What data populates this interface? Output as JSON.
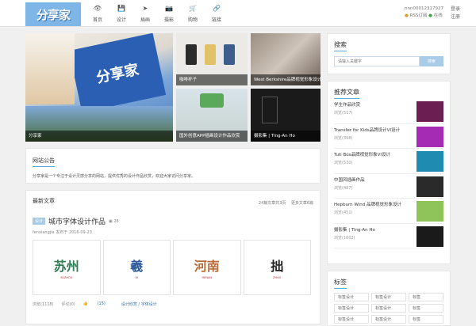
{
  "header": {
    "logo_text": "分享家",
    "nav": [
      {
        "icon": "eye-icon",
        "glyph": "👁",
        "label": "首页"
      },
      {
        "icon": "save-icon",
        "glyph": "💾",
        "label": "设计"
      },
      {
        "icon": "send-icon",
        "glyph": "➤",
        "label": "插画"
      },
      {
        "icon": "camera-icon",
        "glyph": "📷",
        "label": "摄影"
      },
      {
        "icon": "cart-icon",
        "glyph": "🛒",
        "label": "购物"
      },
      {
        "icon": "link-icon",
        "glyph": "🔗",
        "label": "链接"
      }
    ],
    "user_id": "nnn00012317927",
    "rss_label": "RSS订阅",
    "online_label": "在线",
    "login": "登录",
    "register": "注册"
  },
  "featured": {
    "main_caption": "分享家",
    "tile2_caption": "咖啡杯子",
    "tile3_caption": "West Berkshire品牌视觉形象设计",
    "tile4_caption": "国外创意APP插画设计作品欣赏",
    "tile5_caption": "摄影集 | Ting-An Ho"
  },
  "notice": {
    "title": "网站公告",
    "text": "分享家是一个专注于设计灵感分享的网站，提供优秀的设计作品欣赏，欢迎大家访问分享家。"
  },
  "latest": {
    "title": "最新文章",
    "count_text": "24篇文章共3页",
    "more_text": "更多文章6篇",
    "post": {
      "tag": "设计",
      "title": "城市字体设计作品",
      "pic_count": "28",
      "author": "fenxiangjia",
      "category": "发布于",
      "date": "2016-09-23"
    },
    "thumbs": [
      {
        "big": "苏州",
        "small": "SUZHOU",
        "color": "#2e7d55"
      },
      {
        "big": "羲",
        "small": "XI",
        "color": "#2d5a9e"
      },
      {
        "big": "河南",
        "small": "HENAN",
        "color": "#b86a36"
      },
      {
        "big": "拙",
        "small": "ZHUO",
        "color": "#222"
      }
    ],
    "views": "浏览(1118)",
    "comments": "评论(0)",
    "likes": "(15)",
    "links": "设计欣赏 / 字体设计"
  },
  "sidebar": {
    "search_title": "搜索",
    "search_placeholder": "请输入关键字",
    "search_button": "搜索",
    "rec_title": "推荐文章",
    "rec_items": [
      {
        "name": "学生作品欣赏",
        "views": "浏览(517)",
        "color": "#6a1e52"
      },
      {
        "name": "Transfer for Kids品牌设计VI设计",
        "views": "浏览(398)",
        "color": "#a52bb5"
      },
      {
        "name": "Tuti Box品牌视觉形象VI设计",
        "views": "浏览(530)",
        "color": "#1f8bb0"
      },
      {
        "name": "中国风插画作品",
        "views": "浏览(487)",
        "color": "#2a2a2a"
      },
      {
        "name": "Hepburn Wind 品牌视觉形象设计",
        "views": "浏览(451)",
        "color": "#8fc45a"
      },
      {
        "name": "摄影集 | Ting-An Ho",
        "views": "浏览(1002)",
        "color": "#1a1a1a"
      }
    ],
    "tags_title": "标签",
    "tags": [
      "标签设计",
      "标签设计",
      "标签",
      "标签设计",
      "标签设计",
      "标签",
      "标签设计",
      "标签设计",
      "标签"
    ]
  }
}
